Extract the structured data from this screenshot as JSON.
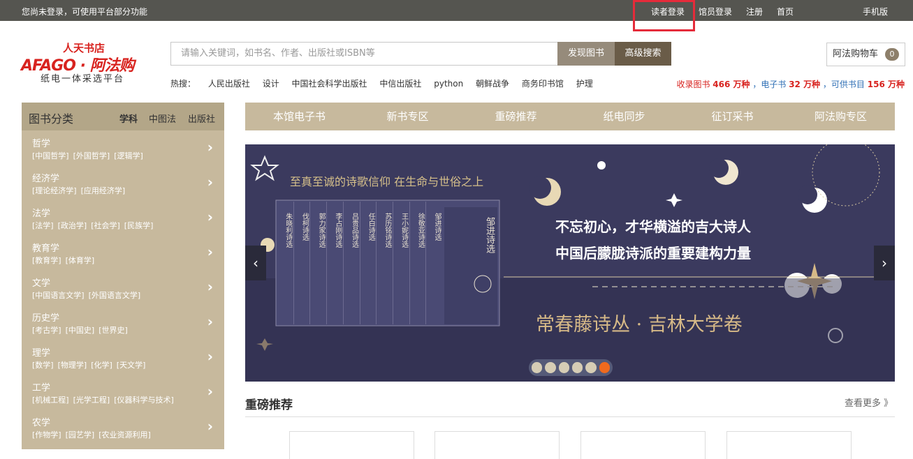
{
  "topbar": {
    "notice": "您尚未登录，可使用平台部分功能",
    "links": [
      "读者登录",
      "馆员登录",
      "注册",
      "首页",
      "手机版"
    ]
  },
  "logo": {
    "line1": "人天书店",
    "line2": "AFAGO · 阿法购",
    "line3": "纸电一体采选平台"
  },
  "search": {
    "placeholder": "请输入关键词，如书名、作者、出版社或ISBN等",
    "discover_label": "发现图书",
    "advanced_label": "高级搜索"
  },
  "hot": {
    "label": "热搜：",
    "terms": [
      "人民出版社",
      "设计",
      "中国社会科学出版社",
      "中信出版社",
      "python",
      "朝鲜战争",
      "商务印书馆",
      "护理"
    ]
  },
  "cart": {
    "label": "阿法购物车",
    "count": "0"
  },
  "stats": {
    "p1": "收录图书",
    "v1": "466 万种",
    "p2": "，电子书",
    "v2": "32 万种",
    "p3": "，可供书目",
    "v3": "156 万种"
  },
  "sidebar": {
    "title": "图书分类",
    "tabs": [
      "学科",
      "中图法",
      "出版社"
    ],
    "categories": [
      {
        "name": "哲学",
        "subs": [
          "[中国哲学]",
          "[外国哲学]",
          "[逻辑学]"
        ]
      },
      {
        "name": "经济学",
        "subs": [
          "[理论经济学]",
          "[应用经济学]"
        ]
      },
      {
        "name": "法学",
        "subs": [
          "[法学]",
          "[政治学]",
          "[社会学]",
          "[民族学]"
        ]
      },
      {
        "name": "教育学",
        "subs": [
          "[教育学]",
          "[体育学]"
        ]
      },
      {
        "name": "文学",
        "subs": [
          "[中国语言文学]",
          "[外国语言文学]"
        ]
      },
      {
        "name": "历史学",
        "subs": [
          "[考古学]",
          "[中国史]",
          "[世界史]"
        ]
      },
      {
        "name": "理学",
        "subs": [
          "[数学]",
          "[物理学]",
          "[化学]",
          "[天文学]"
        ]
      },
      {
        "name": "工学",
        "subs": [
          "[机械工程]",
          "[光学工程]",
          "[仪器科学与技术]"
        ]
      },
      {
        "name": "农学",
        "subs": [
          "[作物学]",
          "[园艺学]",
          "[农业资源利用]"
        ]
      }
    ]
  },
  "nav": [
    "本馆电子书",
    "新书专区",
    "重磅推荐",
    "纸电同步",
    "征订采书",
    "阿法购专区"
  ],
  "banner": {
    "top_text": "至真至诚的诗歌信仰  在生命与世俗之上",
    "headline1": "不忘初心，才华横溢的吉大诗人",
    "headline2": "中国后朦胧诗派的重要建构力量",
    "series": "常春藤诗丛 · 吉林大学卷",
    "book_spines": [
      "朱晓利诗选",
      "伐柯诗选",
      "郭力家诗选",
      "李占刚诗选",
      "吕贵品诗选",
      "任白诗选",
      "苏历铭诗选",
      "王小妮诗选",
      "徐敬亚诗选",
      "邹进诗选"
    ],
    "cover_title": "邹进诗选",
    "slide_count": 6,
    "active_slide": 6
  },
  "section": {
    "title": "重磅推荐",
    "more": "查看更多 》"
  },
  "colors": {
    "accent": "#c7b99d",
    "brand_red": "#d8231f",
    "topbar": "#555550"
  }
}
